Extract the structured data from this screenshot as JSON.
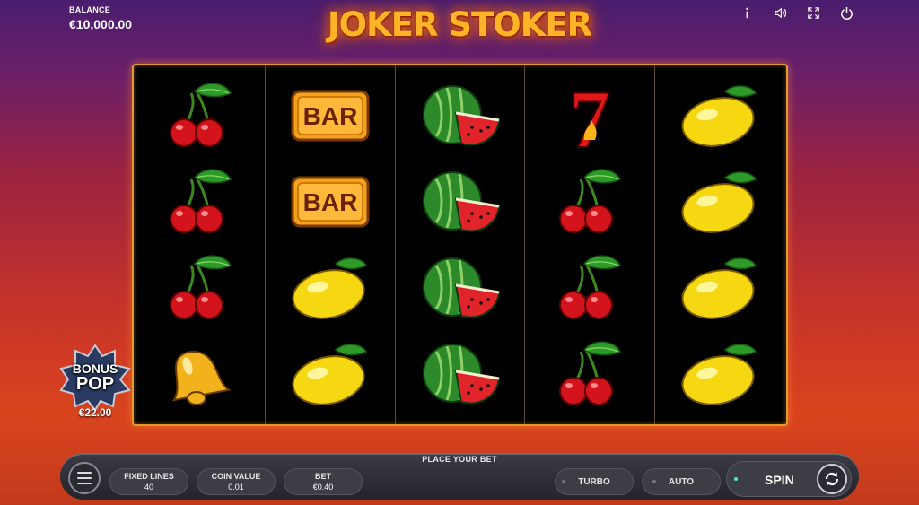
{
  "header": {
    "balance_label": "BALANCE",
    "balance_value": "€10,000.00",
    "title": "JOKER STOKER",
    "icons": [
      "info-icon",
      "sound-icon",
      "fullscreen-icon",
      "power-icon"
    ]
  },
  "reels": [
    [
      "cherry",
      "cherry",
      "cherry",
      "bell"
    ],
    [
      "bar",
      "bar",
      "lemon",
      "lemon"
    ],
    [
      "watermelon",
      "watermelon",
      "watermelon",
      "watermelon"
    ],
    [
      "seven",
      "cherry",
      "cherry",
      "cherry"
    ],
    [
      "lemon",
      "lemon",
      "lemon",
      "lemon"
    ]
  ],
  "symbols": {
    "bar_text": "BAR",
    "seven_text": "7"
  },
  "bonus": {
    "word1": "BONUS",
    "word2": "POP",
    "amount": "€22.00"
  },
  "controls": {
    "place_bet": "PLACE YOUR BET",
    "fixed_lines_label": "FIXED LINES",
    "fixed_lines_value": "40",
    "coin_value_label": "COIN VALUE",
    "coin_value_value": "0.01",
    "bet_label": "BET",
    "bet_value": "€0.40",
    "turbo_label": "TURBO",
    "auto_label": "AUTO",
    "spin_label": "SPIN"
  },
  "colors": {
    "accent_gold": "#e09a2a",
    "title_orange": "#ffb428",
    "spin_indicator": "#58e0d8"
  }
}
